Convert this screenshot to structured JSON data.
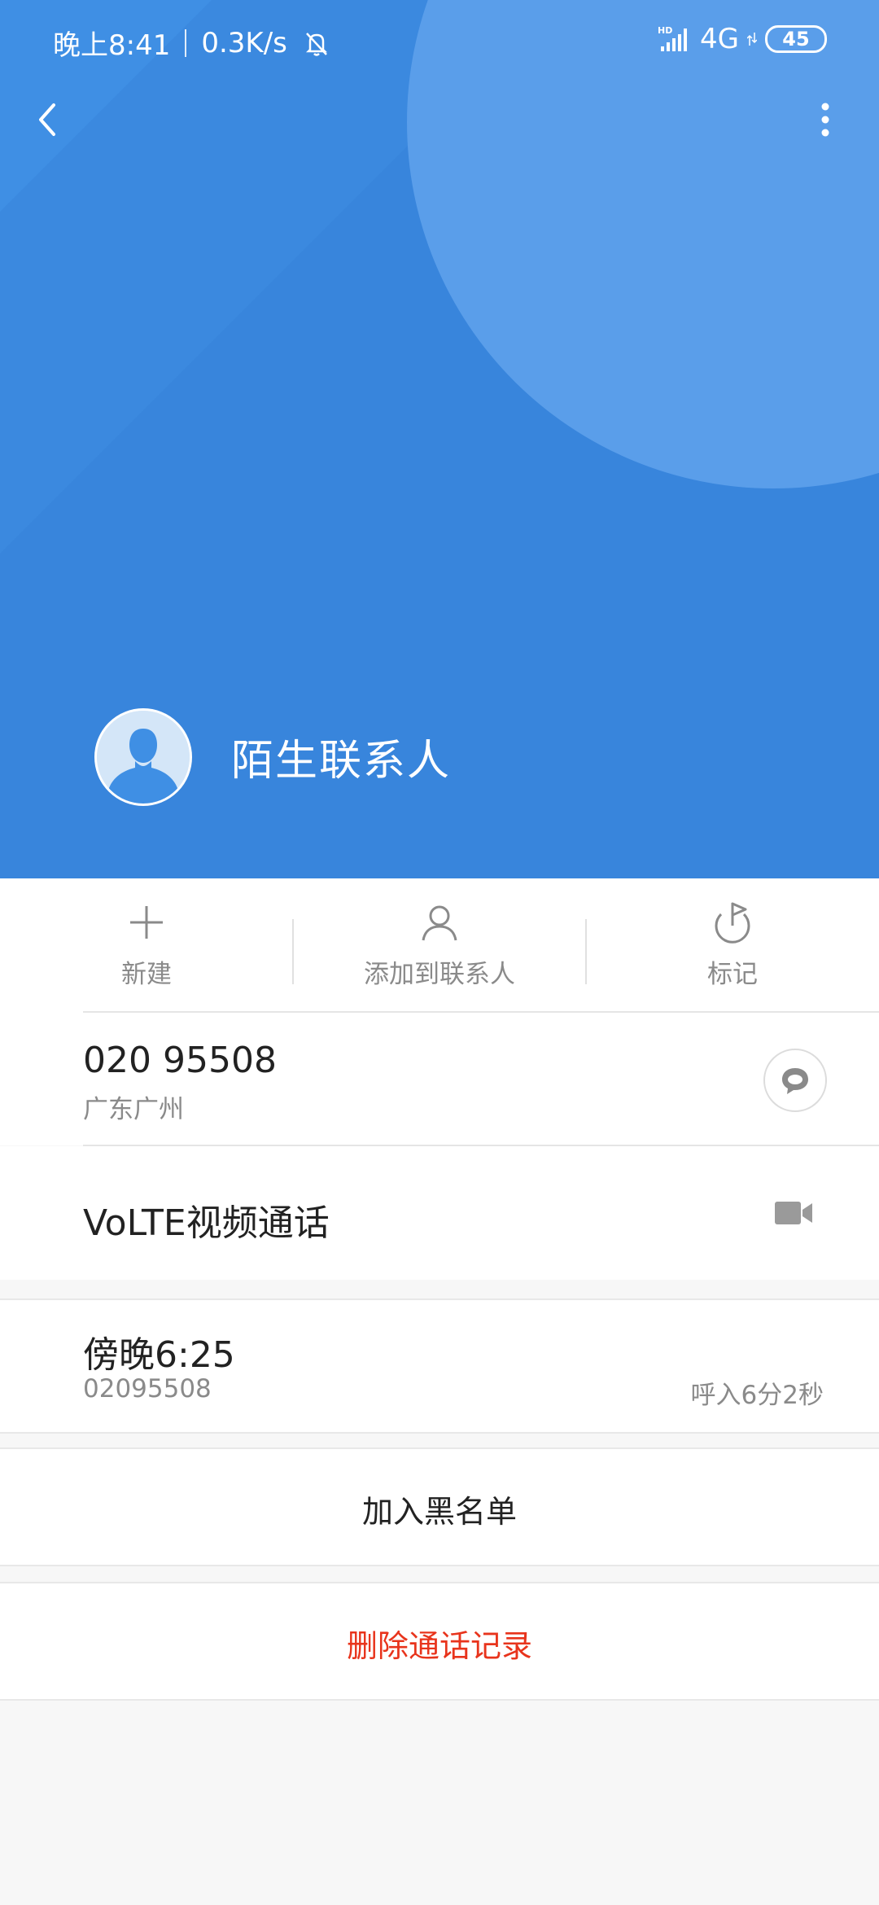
{
  "status_bar": {
    "time": "晚上8:41",
    "speed": "0.3K/s",
    "network": "4G",
    "battery": "45"
  },
  "contact": {
    "name": "陌生联系人"
  },
  "actions": [
    {
      "label": "新建",
      "icon": "plus-icon"
    },
    {
      "label": "添加到联系人",
      "icon": "person-icon"
    },
    {
      "label": "标记",
      "icon": "flag-icon"
    }
  ],
  "phone": {
    "number": "020 95508",
    "location": "广东广州"
  },
  "volte": {
    "label": "VoLTE视频通话"
  },
  "call_log": {
    "time": "傍晚6:25",
    "number": "02095508",
    "description": "呼入6分2秒"
  },
  "buttons": {
    "blacklist": "加入黑名单",
    "delete": "删除通话记录"
  },
  "colors": {
    "header_blue": "#3f8fe4",
    "delete_red": "#e8341c"
  }
}
